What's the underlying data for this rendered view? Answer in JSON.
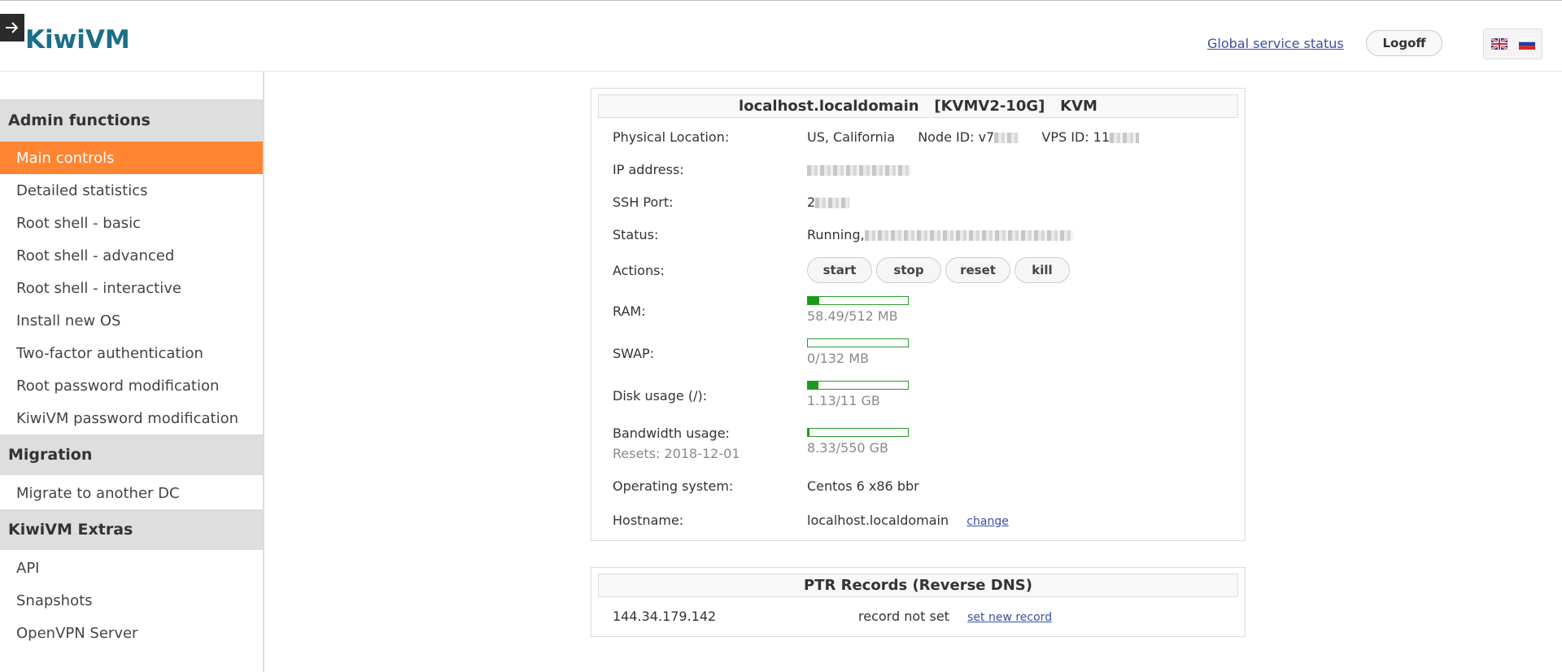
{
  "header": {
    "logo_text": "KiwiVM",
    "global_status_link": "Global service status",
    "logoff_label": "Logoff",
    "languages": [
      "en-flag-icon",
      "ru-flag-icon"
    ]
  },
  "sidebar": {
    "sections": [
      {
        "title": "Admin functions",
        "items": [
          {
            "label": "Main controls",
            "active": true
          },
          {
            "label": "Detailed statistics"
          },
          {
            "label": "Root shell - basic"
          },
          {
            "label": "Root shell - advanced"
          },
          {
            "label": "Root shell - interactive"
          },
          {
            "label": "Install new OS"
          },
          {
            "label": "Two-factor authentication"
          },
          {
            "label": "Root password modification"
          },
          {
            "label": "KiwiVM password modification"
          }
        ]
      },
      {
        "title": "Migration",
        "items": [
          {
            "label": "Migrate to another DC"
          }
        ]
      },
      {
        "title": "KiwiVM Extras",
        "items": [
          {
            "label": "API"
          },
          {
            "label": "Snapshots"
          },
          {
            "label": "OpenVPN Server"
          }
        ]
      }
    ]
  },
  "main_panel": {
    "title": "localhost.localdomain   [KVMV2-10G]   KVM",
    "location": {
      "label": "Physical Location:",
      "value": "US, California",
      "node_label": "Node ID: v7",
      "vps_label": "VPS ID: 11"
    },
    "ip": {
      "label": "IP address:"
    },
    "ssh": {
      "label": "SSH Port:",
      "value_prefix": "2"
    },
    "status": {
      "label": "Status:",
      "value_prefix": "Running,"
    },
    "actions": {
      "label": "Actions:",
      "buttons": [
        "start",
        "stop",
        "reset",
        "kill"
      ]
    },
    "ram": {
      "label": "RAM:",
      "text": "58.49/512 MB",
      "fraction": 0.114
    },
    "swap": {
      "label": "SWAP:",
      "text": "0/132 MB",
      "fraction": 0.0
    },
    "disk": {
      "label": "Disk usage (/):",
      "text": "1.13/11 GB",
      "fraction": 0.103
    },
    "bandwidth": {
      "label": "Bandwidth usage:",
      "resets": "Resets: 2018-12-01",
      "text": "8.33/550 GB",
      "fraction": 0.015
    },
    "os": {
      "label": "Operating system:",
      "value": "Centos 6 x86 bbr"
    },
    "hostname": {
      "label": "Hostname:",
      "value": "localhost.localdomain",
      "change_link": "change"
    }
  },
  "ptr_panel": {
    "title": "PTR Records (Reverse DNS)",
    "ip": "144.34.179.142",
    "status": "record not set",
    "link": "set new record"
  },
  "colors": {
    "accent": "#ff8533",
    "bar_green": "#1b9a1b",
    "logo": "#1b6f86"
  }
}
